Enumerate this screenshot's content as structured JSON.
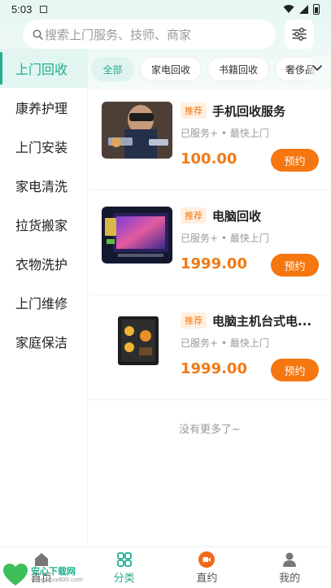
{
  "status_bar": {
    "time": "5:03"
  },
  "search": {
    "placeholder": "搜索上门服务、技师、商家"
  },
  "sidebar": {
    "items": [
      {
        "label": "上门回收",
        "active": true
      },
      {
        "label": "康养护理"
      },
      {
        "label": "上门安装"
      },
      {
        "label": "家电清洗"
      },
      {
        "label": "拉货搬家"
      },
      {
        "label": "衣物洗护"
      },
      {
        "label": "上门维修"
      },
      {
        "label": "家庭保洁"
      }
    ]
  },
  "chips": [
    {
      "label": "全部",
      "active": true
    },
    {
      "label": "家电回收"
    },
    {
      "label": "书籍回收"
    },
    {
      "label": "奢侈品"
    }
  ],
  "products": [
    {
      "badge": "推荐",
      "title": "手机回收服务",
      "subtitle": "已服务+ • 最快上门",
      "price": "100.00",
      "button": "预约"
    },
    {
      "badge": "推荐",
      "title": "电脑回收",
      "subtitle": "已服务+ • 最快上门",
      "price": "1999.00",
      "button": "预约"
    },
    {
      "badge": "推荐",
      "title": "电脑主机台式电...",
      "subtitle": "已服务+ • 最快上门",
      "price": "1999.00",
      "button": "预约"
    }
  ],
  "list_end_text": "没有更多了~",
  "bottom_nav": [
    {
      "label": "首页",
      "icon": "home-icon"
    },
    {
      "label": "分类",
      "icon": "grid-icon",
      "active": true
    },
    {
      "label": "直约",
      "icon": "video-icon"
    },
    {
      "label": "我的",
      "icon": "user-icon"
    }
  ],
  "watermark": {
    "title": "安心下载网",
    "url": "www.jnva800.com"
  },
  "colors": {
    "accent": "#1fae8e",
    "accent_bg": "#e3f5f0",
    "price": "#f07a14",
    "button": "#f6760f",
    "badge_bg": "#fff0e2"
  }
}
